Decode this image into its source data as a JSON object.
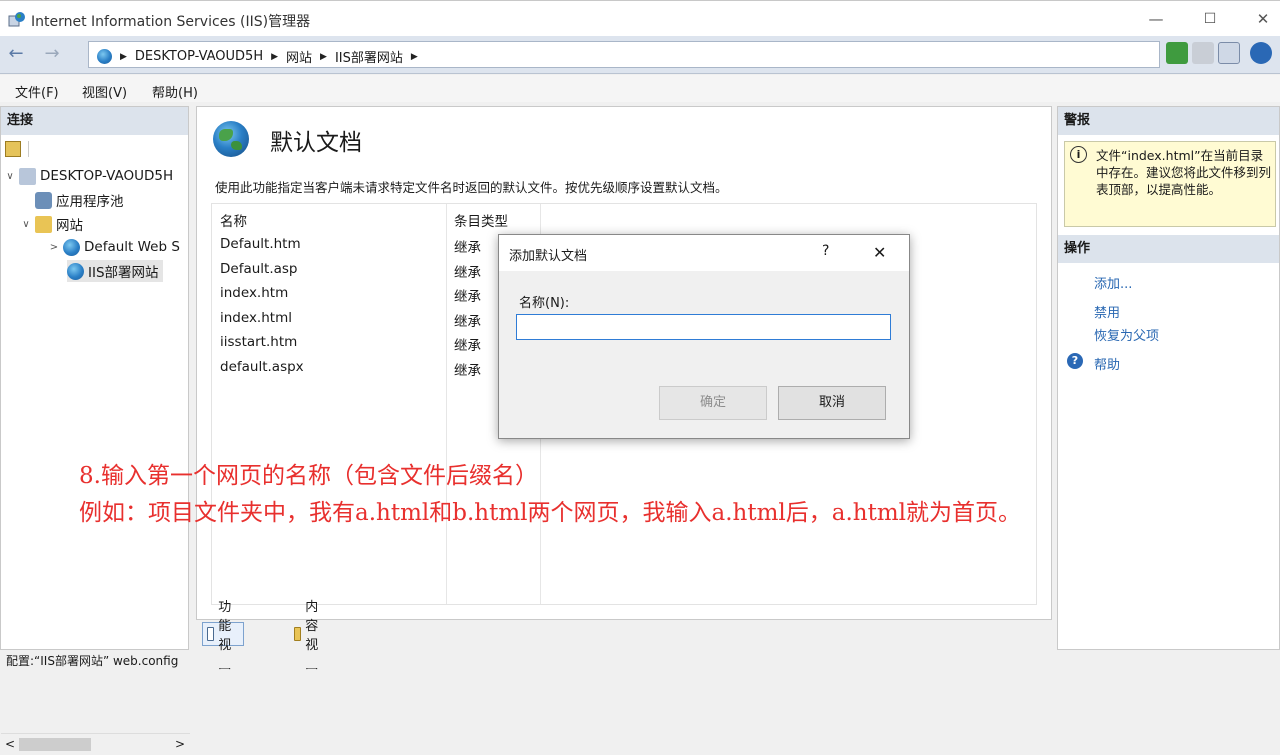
{
  "window": {
    "title": "Internet Information Services (IIS)管理器",
    "min_glyph": "—",
    "max_glyph": "☐",
    "close_glyph": "✕"
  },
  "address": {
    "crumbs": [
      "DESKTOP-VAOUD5H",
      "网站",
      "IIS部署网站"
    ]
  },
  "menu": [
    "文件(F)",
    "视图(V)",
    "帮助(H)"
  ],
  "left": {
    "title": "连接",
    "tree": [
      {
        "label": "DESKTOP-VAOUD5H",
        "twisty": "∨"
      },
      {
        "label": "应用程序池",
        "twisty": ""
      },
      {
        "label": "网站",
        "twisty": "∨"
      },
      {
        "label": "Default Web S",
        "twisty": ">"
      },
      {
        "label": "IIS部署网站",
        "twisty": ""
      }
    ]
  },
  "center": {
    "title": "默认文档",
    "description": "使用此功能指定当客户端未请求特定文件名时返回的默认文件。按优先级顺序设置默认文档。",
    "col_name": "名称",
    "col_type": "条目类型",
    "rows": [
      {
        "name": "Default.htm",
        "type": "继承"
      },
      {
        "name": "Default.asp",
        "type": "继承"
      },
      {
        "name": "index.htm",
        "type": "继承"
      },
      {
        "name": "index.html",
        "type": "继承"
      },
      {
        "name": "iisstart.htm",
        "type": "继承"
      },
      {
        "name": "default.aspx",
        "type": "继承"
      }
    ],
    "tab_features": "功能视图",
    "tab_content": "内容视图"
  },
  "right": {
    "alerts_title": "警报",
    "alert_text": "文件“index.html”在当前目录中存在。建议您将此文件移到列表顶部，以提高性能。",
    "actions_title": "操作",
    "actions": [
      "添加...",
      "禁用",
      "恢复为父项"
    ],
    "help": "帮助"
  },
  "dialog": {
    "title": "添加默认文档",
    "help_glyph": "?",
    "close_glyph": "✕",
    "name_label": "名称(N):",
    "name_value": "",
    "ok": "确定",
    "cancel": "取消"
  },
  "annotation": {
    "line1": "8.输入第一个网页的名称（包含文件后缀名）",
    "line2": "例如：项目文件夹中，我有a.html和b.html两个网页，我输入a.html后，a.html就为首页。"
  },
  "status": "配置:“IIS部署网站” web.config",
  "colors": {
    "annotation": "#e8302e",
    "link": "#2867b2",
    "pane_header": "#dce3ec",
    "alert_bg": "#fffbd3"
  }
}
